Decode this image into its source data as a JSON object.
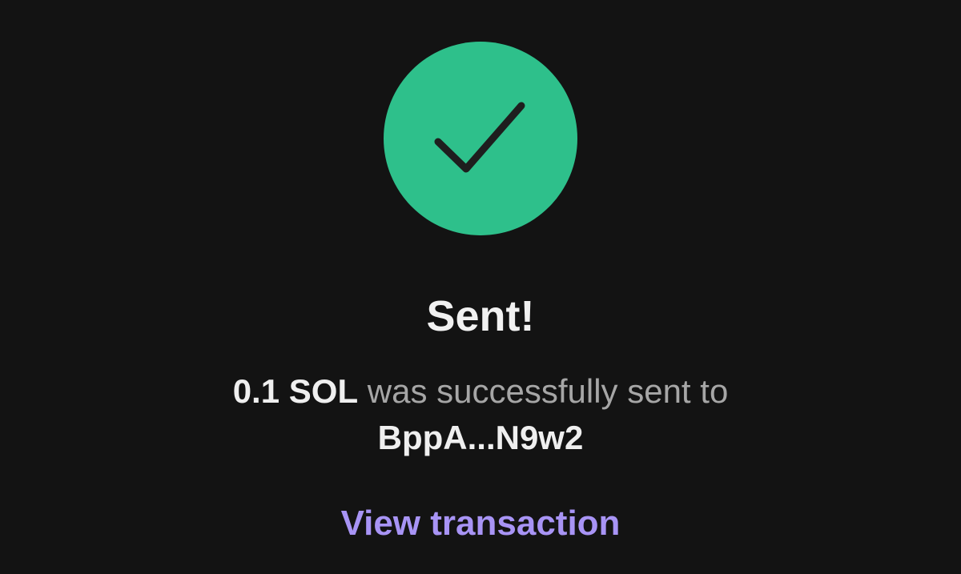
{
  "status_icon": {
    "name": "checkmark-icon",
    "background_color": "#2EC08B",
    "stroke_color": "#1E1E1E"
  },
  "title": "Sent!",
  "message": {
    "amount": "0.1 SOL",
    "text": "was successfully sent to",
    "recipient": "BppA...N9w2"
  },
  "link": {
    "label": "View transaction",
    "color": "#A894F5"
  }
}
